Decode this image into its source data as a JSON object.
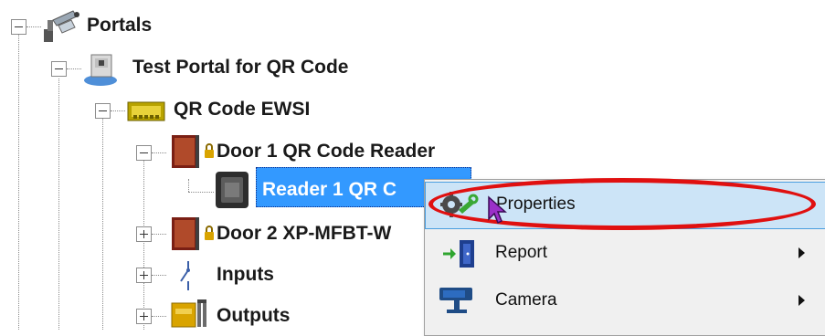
{
  "tree": {
    "portals_label": "Portals",
    "test_portal_label": "Test Portal for QR Code",
    "qr_ewsi_label": "QR Code EWSI",
    "door1_label": "Door 1 QR Code Reader",
    "reader1_label": "Reader 1 QR C",
    "door2_label": "Door 2 XP-MFBT-W",
    "inputs_label": "Inputs",
    "outputs_label": "Outputs"
  },
  "context_menu": {
    "items": [
      {
        "label": "Properties",
        "icon": "properties-icon",
        "has_submenu": false
      },
      {
        "label": "Report",
        "icon": "report-icon",
        "has_submenu": true
      },
      {
        "label": "Camera",
        "icon": "camera-icon",
        "has_submenu": true
      }
    ]
  },
  "colors": {
    "selection": "#3399ff",
    "menu_highlight": "#cce4f7",
    "annotation_oval": "#e01010"
  }
}
